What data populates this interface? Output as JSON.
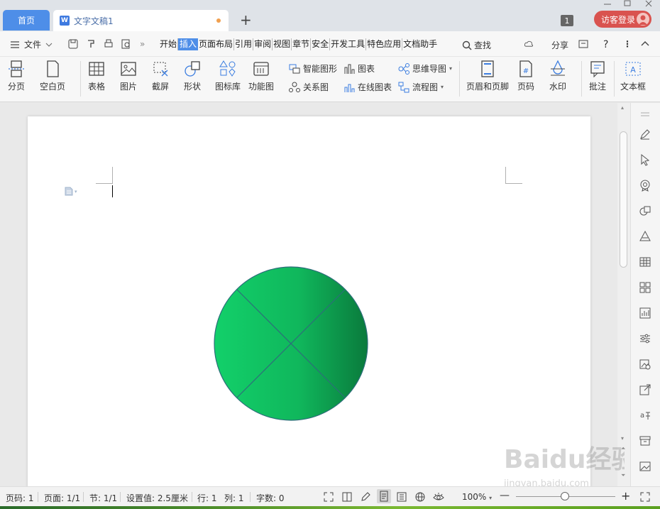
{
  "tabs": {
    "home": "首页",
    "doc": "文字文稿1",
    "count_badge": "1",
    "guest_login": "访客登录"
  },
  "menu": {
    "file": "文件",
    "tabs": [
      "开始",
      "插入",
      "页面布局",
      "引用",
      "审阅",
      "视图",
      "章节",
      "安全",
      "开发工具",
      "特色应用",
      "文档助手"
    ],
    "active_tab": "插入",
    "search": "查找",
    "share": "分享"
  },
  "ribbon": {
    "page_break": "分页",
    "blank_page": "空白页",
    "table": "表格",
    "picture": "图片",
    "screenshot": "截屏",
    "shape": "形状",
    "icon_lib": "图标库",
    "function_chart": "功能图",
    "smart_graphic": "智能图形",
    "chart": "图表",
    "mind_map": "思维导图",
    "relation_chart": "关系图",
    "online_chart": "在线图表",
    "flowchart": "流程图",
    "header_footer": "页眉和页脚",
    "page_number": "页码",
    "watermark": "水印",
    "comment": "批注",
    "textbox": "文本框"
  },
  "status": {
    "page_num": "页码: 1",
    "page_of": "页面: 1/1",
    "section": "节: 1/1",
    "setting": "设置值: 2.5厘米",
    "row": "行: 1",
    "col": "列: 1",
    "word_count": "字数: 0",
    "zoom": "100%"
  },
  "watermark": {
    "brand": "Baidu经验",
    "url": "jingyan.baidu.com"
  },
  "colors": {
    "accent": "#4e8ee8",
    "circle_light": "#12d06a",
    "circle_dark": "#0a7a3c",
    "login": "#d9534f"
  }
}
